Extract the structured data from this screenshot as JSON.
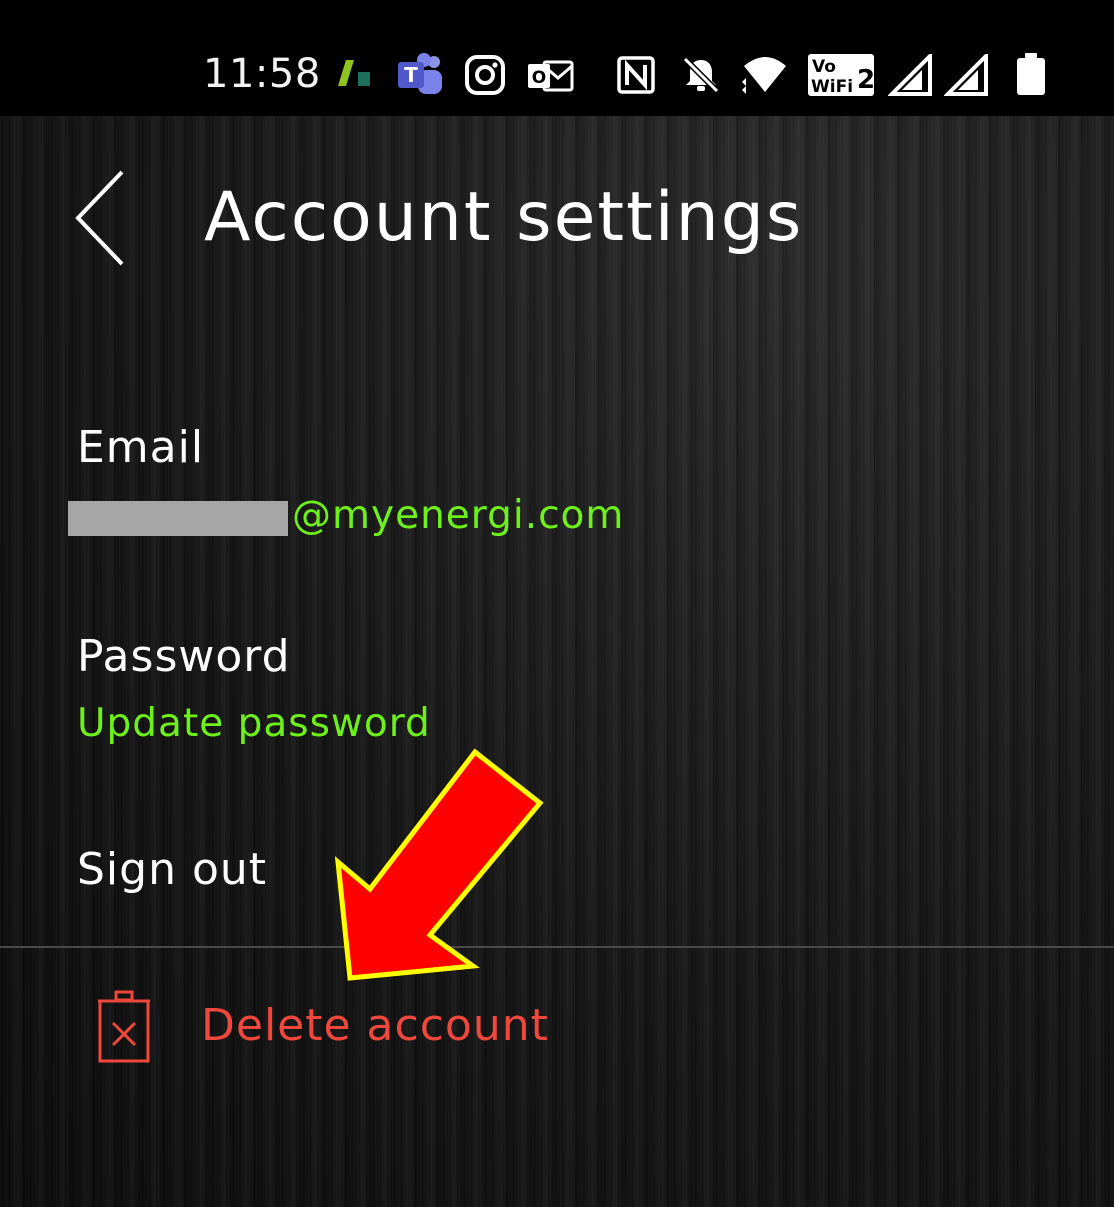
{
  "status_bar": {
    "time": "11:58",
    "icons": [
      "app-icon",
      "teams-icon",
      "instagram-icon",
      "outlook-icon",
      "nfc-icon",
      "mute-bell-icon",
      "wifi-icon",
      "vowifi-icon",
      "signal-icon",
      "signal-icon",
      "battery-icon"
    ],
    "vowifi_top": "Vo",
    "vowifi_bottom": "WiFi",
    "vowifi_number": "2",
    "teams_letter": "T",
    "outlook_letter": "O"
  },
  "header": {
    "title": "Account settings",
    "back_icon": "chevron-left-icon"
  },
  "email": {
    "label": "Email",
    "value": "@myenergi.com"
  },
  "password": {
    "label": "Password",
    "action": "Update password"
  },
  "sign_out": {
    "label": "Sign out"
  },
  "delete_account": {
    "label": "Delete account",
    "icon": "trash-icon"
  },
  "colors": {
    "accent_green": "#6ef01a",
    "danger_red": "#f0473d",
    "annotation_red": "#ff0000",
    "annotation_outline": "#ffff00"
  }
}
